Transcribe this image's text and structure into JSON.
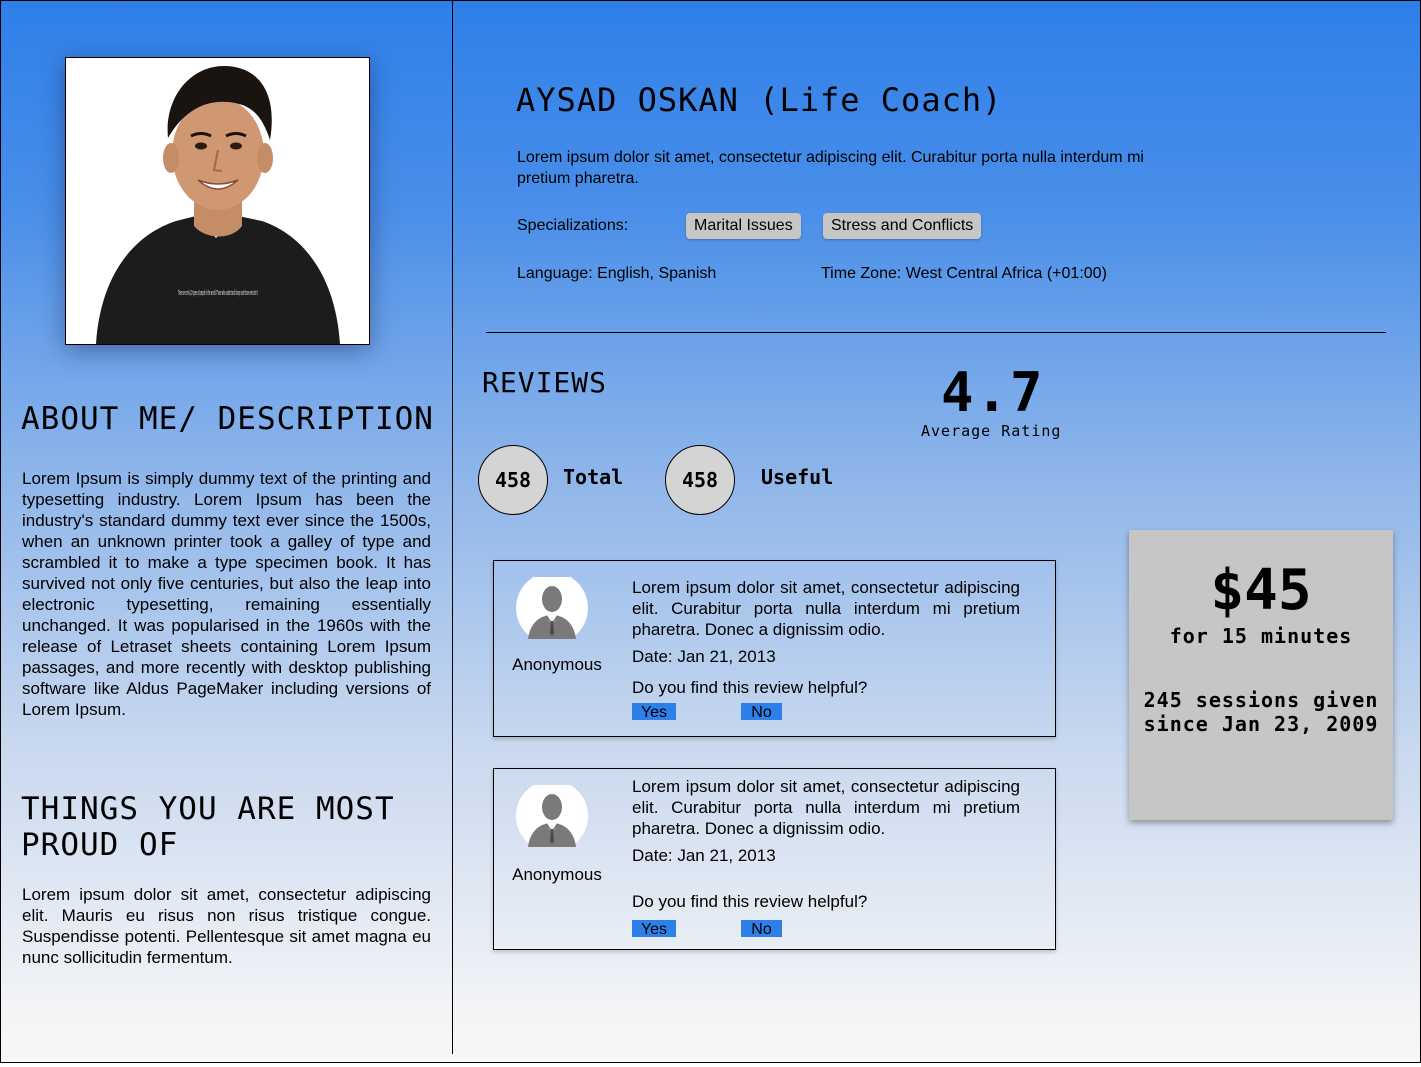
{
  "profile": {
    "name": "AYSAD OSKAN (Life Coach)",
    "description": "Lorem ipsum dolor sit amet, consectetur adipiscing elit. Curabitur porta nulla interdum mi pretium pharetra.",
    "specializations_label": "Specializations:",
    "specializations": [
      "Marital Issues",
      "Stress and Conflicts"
    ],
    "language": "Language: English, Spanish",
    "time_zone": "Time Zone: West Central Africa (+01:00)",
    "photo_shirt_text": "There are only 10 types of people in the world: Those who understand binary and those who don't."
  },
  "about": {
    "title": "ABOUT ME/ DESCRIPTION",
    "text": "Lorem Ipsum is simply dummy text of the printing and typesetting industry. Lorem Ipsum has been the industry's standard dummy text ever since the 1500s, when an unknown printer took a galley of type and scrambled it to make a type specimen book. It has survived not only five centuries, but also the leap into electronic typesetting, remaining essentially unchanged. It was popularised in the 1960s with the release of Letraset sheets containing Lorem Ipsum passages, and more recently with desktop publishing software like Aldus PageMaker including versions of Lorem Ipsum."
  },
  "proud": {
    "title": "THINGS YOU ARE MOST PROUD OF",
    "text": "Lorem ipsum dolor sit amet, consectetur adipiscing elit. Mauris eu risus non risus tristique congue. Suspendisse potenti. Pellentesque sit amet magna eu nunc sollicitudin fermentum."
  },
  "reviews": {
    "title": "REVIEWS",
    "average_rating": "4.7",
    "average_rating_label": "Average Rating",
    "total_count": "458",
    "total_label": "Total",
    "useful_count": "458",
    "useful_label": "Useful",
    "items": [
      {
        "reviewer": "Anonymous",
        "text": "Lorem ipsum dolor sit amet, consectetur adipiscing elit. Curabitur porta nulla interdum mi pretium pharetra. Donec a dignissim odio.",
        "date": "Date: Jan 21, 2013",
        "question": "Do you find this review helpful?",
        "yes_label": "Yes",
        "no_label": "No"
      },
      {
        "reviewer": "Anonymous",
        "text": "Lorem ipsum dolor sit amet, consectetur adipiscing elit. Curabitur porta nulla interdum mi pretium pharetra. Donec a dignissim odio.",
        "date": "Date: Jan 21, 2013",
        "question": "Do you find this review helpful?",
        "yes_label": "Yes",
        "no_label": "No"
      }
    ]
  },
  "pricing": {
    "amount": "$45",
    "duration": "for 15 minutes",
    "sessions_line1": "245 sessions given",
    "sessions_line2": "since Jan 23, 2009"
  },
  "colors": {
    "accent": "#2f7fe9",
    "chip": "#c6c6c6",
    "card": "#c6c6c6"
  },
  "icons": {
    "avatar": "user-avatar-icon"
  }
}
